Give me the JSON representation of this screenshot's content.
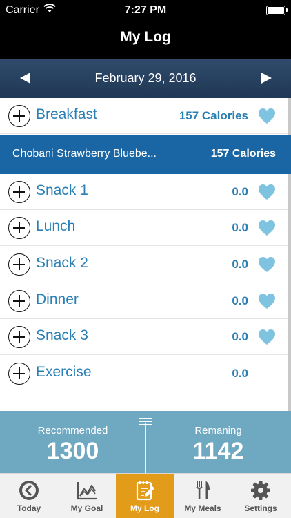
{
  "status_bar": {
    "carrier": "Carrier",
    "time": "7:27 PM"
  },
  "nav": {
    "title": "My Log"
  },
  "date_bar": {
    "date": "February 29, 2016"
  },
  "meals": [
    {
      "label": "Breakfast",
      "value": "157 Calories",
      "favorite": true
    },
    {
      "label": "Snack 1",
      "value": "0.0",
      "favorite": true
    },
    {
      "label": "Lunch",
      "value": "0.0",
      "favorite": true
    },
    {
      "label": "Snack 2",
      "value": "0.0",
      "favorite": true
    },
    {
      "label": "Dinner",
      "value": "0.0",
      "favorite": true
    },
    {
      "label": "Snack 3",
      "value": "0.0",
      "favorite": true
    },
    {
      "label": "Exercise",
      "value": "0.0",
      "favorite": false
    }
  ],
  "food_item": {
    "name": "Chobani Strawberry Bluebe...",
    "calories": "157 Calories"
  },
  "summary": {
    "recommended_label": "Recommended",
    "recommended_value": "1300",
    "remaining_label": "Remaning",
    "remaining_value": "1142"
  },
  "tabs": [
    {
      "label": "Today",
      "icon": "clock-back-icon",
      "active": false
    },
    {
      "label": "My Goal",
      "icon": "chart-icon",
      "active": false
    },
    {
      "label": "My Log",
      "icon": "notepad-pencil-icon",
      "active": true
    },
    {
      "label": "My Meals",
      "icon": "fork-knife-icon",
      "active": false
    },
    {
      "label": "Settings",
      "icon": "gear-icon",
      "active": false
    }
  ],
  "colors": {
    "accent_blue": "#2a7fb5",
    "selected_row": "#1a65a3",
    "heart": "#7ec3e0",
    "summary_bg": "#6ea8c1",
    "active_tab": "#e39b1a"
  }
}
